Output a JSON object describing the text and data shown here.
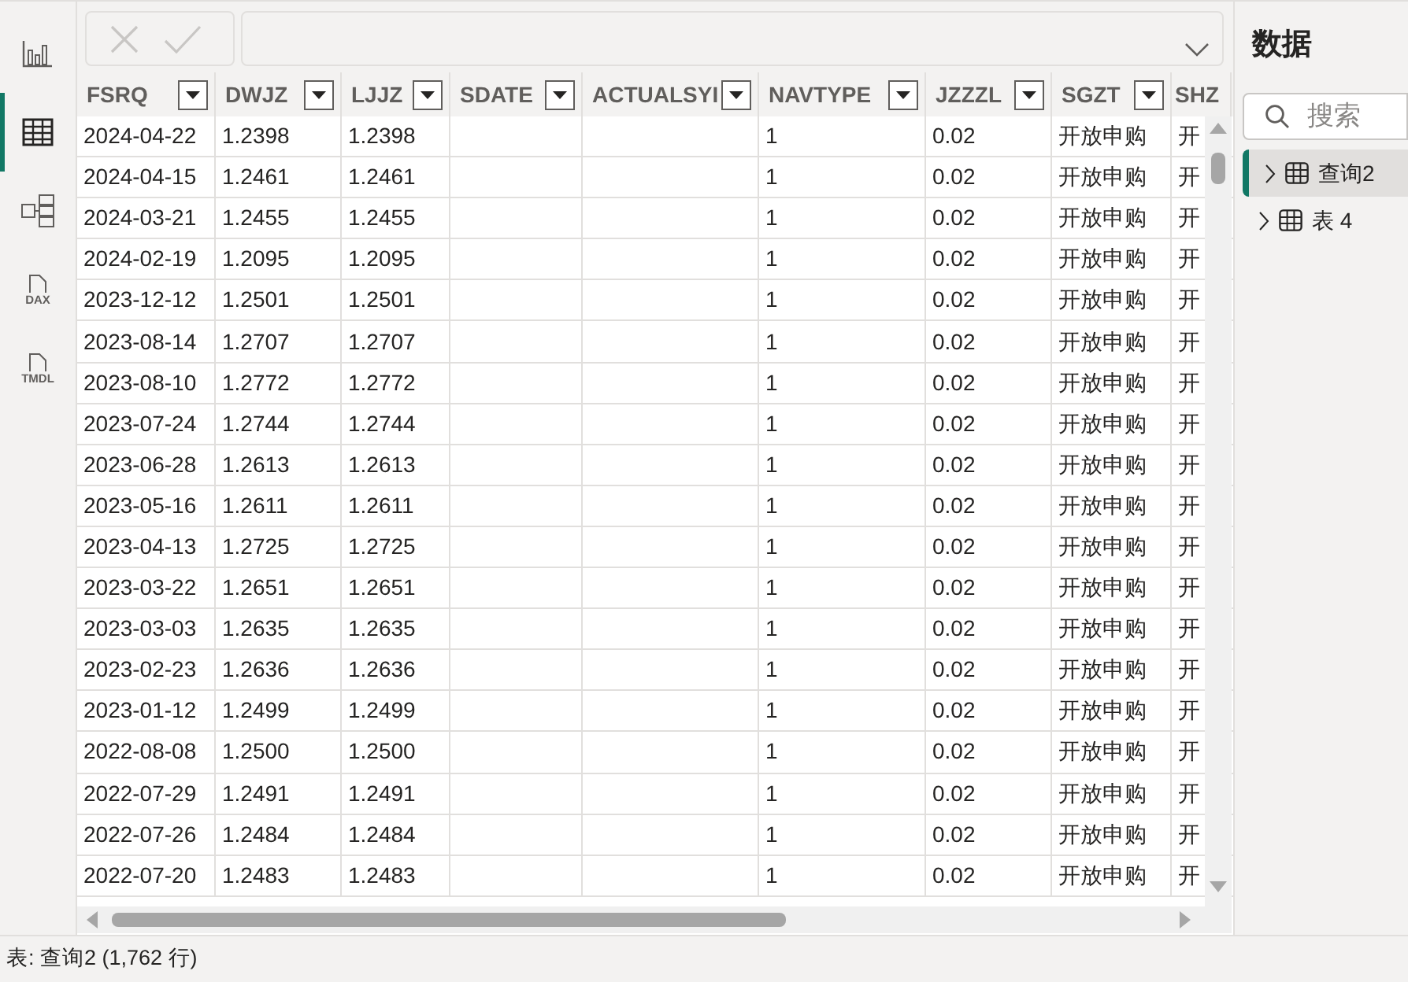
{
  "rail": [
    {
      "kind": "report",
      "selected": false
    },
    {
      "kind": "table",
      "selected": true
    },
    {
      "kind": "model",
      "selected": false
    },
    {
      "kind": "dax",
      "label": "DAX",
      "selected": false
    },
    {
      "kind": "tmdl",
      "label": "TMDL",
      "selected": false
    }
  ],
  "formula_bar": {
    "disabled": true
  },
  "table": {
    "columns": [
      "FSRQ",
      "DWJZ",
      "LJJZ",
      "SDATE",
      "ACTUALSYI",
      "NAVTYPE",
      "JZZZL",
      "SGZT",
      "SHZ"
    ],
    "rows": [
      [
        "2024-04-22",
        "1.2398",
        "1.2398",
        null,
        null,
        "1",
        "0.02",
        "开放申购",
        "开"
      ],
      [
        "2024-04-15",
        "1.2461",
        "1.2461",
        null,
        null,
        "1",
        "0.02",
        "开放申购",
        "开"
      ],
      [
        "2024-03-21",
        "1.2455",
        "1.2455",
        null,
        null,
        "1",
        "0.02",
        "开放申购",
        "开"
      ],
      [
        "2024-02-19",
        "1.2095",
        "1.2095",
        null,
        null,
        "1",
        "0.02",
        "开放申购",
        "开"
      ],
      [
        "2023-12-12",
        "1.2501",
        "1.2501",
        null,
        null,
        "1",
        "0.02",
        "开放申购",
        "开"
      ],
      [
        "2023-08-14",
        "1.2707",
        "1.2707",
        null,
        null,
        "1",
        "0.02",
        "开放申购",
        "开"
      ],
      [
        "2023-08-10",
        "1.2772",
        "1.2772",
        null,
        null,
        "1",
        "0.02",
        "开放申购",
        "开"
      ],
      [
        "2023-07-24",
        "1.2744",
        "1.2744",
        null,
        null,
        "1",
        "0.02",
        "开放申购",
        "开"
      ],
      [
        "2023-06-28",
        "1.2613",
        "1.2613",
        null,
        null,
        "1",
        "0.02",
        "开放申购",
        "开"
      ],
      [
        "2023-05-16",
        "1.2611",
        "1.2611",
        null,
        null,
        "1",
        "0.02",
        "开放申购",
        "开"
      ],
      [
        "2023-04-13",
        "1.2725",
        "1.2725",
        null,
        null,
        "1",
        "0.02",
        "开放申购",
        "开"
      ],
      [
        "2023-03-22",
        "1.2651",
        "1.2651",
        null,
        null,
        "1",
        "0.02",
        "开放申购",
        "开"
      ],
      [
        "2023-03-03",
        "1.2635",
        "1.2635",
        null,
        null,
        "1",
        "0.02",
        "开放申购",
        "开"
      ],
      [
        "2023-02-23",
        "1.2636",
        "1.2636",
        null,
        null,
        "1",
        "0.02",
        "开放申购",
        "开"
      ],
      [
        "2023-01-12",
        "1.2499",
        "1.2499",
        null,
        null,
        "1",
        "0.02",
        "开放申购",
        "开"
      ],
      [
        "2022-08-08",
        "1.2500",
        "1.2500",
        null,
        null,
        "1",
        "0.02",
        "开放申购",
        "开"
      ],
      [
        "2022-07-29",
        "1.2491",
        "1.2491",
        null,
        null,
        "1",
        "0.02",
        "开放申购",
        "开"
      ],
      [
        "2022-07-26",
        "1.2484",
        "1.2484",
        null,
        null,
        "1",
        "0.02",
        "开放申购",
        "开"
      ],
      [
        "2022-07-20",
        "1.2483",
        "1.2483",
        null,
        null,
        "1",
        "0.02",
        "开放申购",
        "开"
      ]
    ]
  },
  "data_pane": {
    "title": "数据",
    "search": {
      "placeholder": "搜索"
    },
    "items": [
      {
        "label": "查询2",
        "selected": true
      },
      {
        "label": "表 4",
        "selected": false
      }
    ]
  },
  "status_bar": "表: 查询2 (1,762 行)"
}
